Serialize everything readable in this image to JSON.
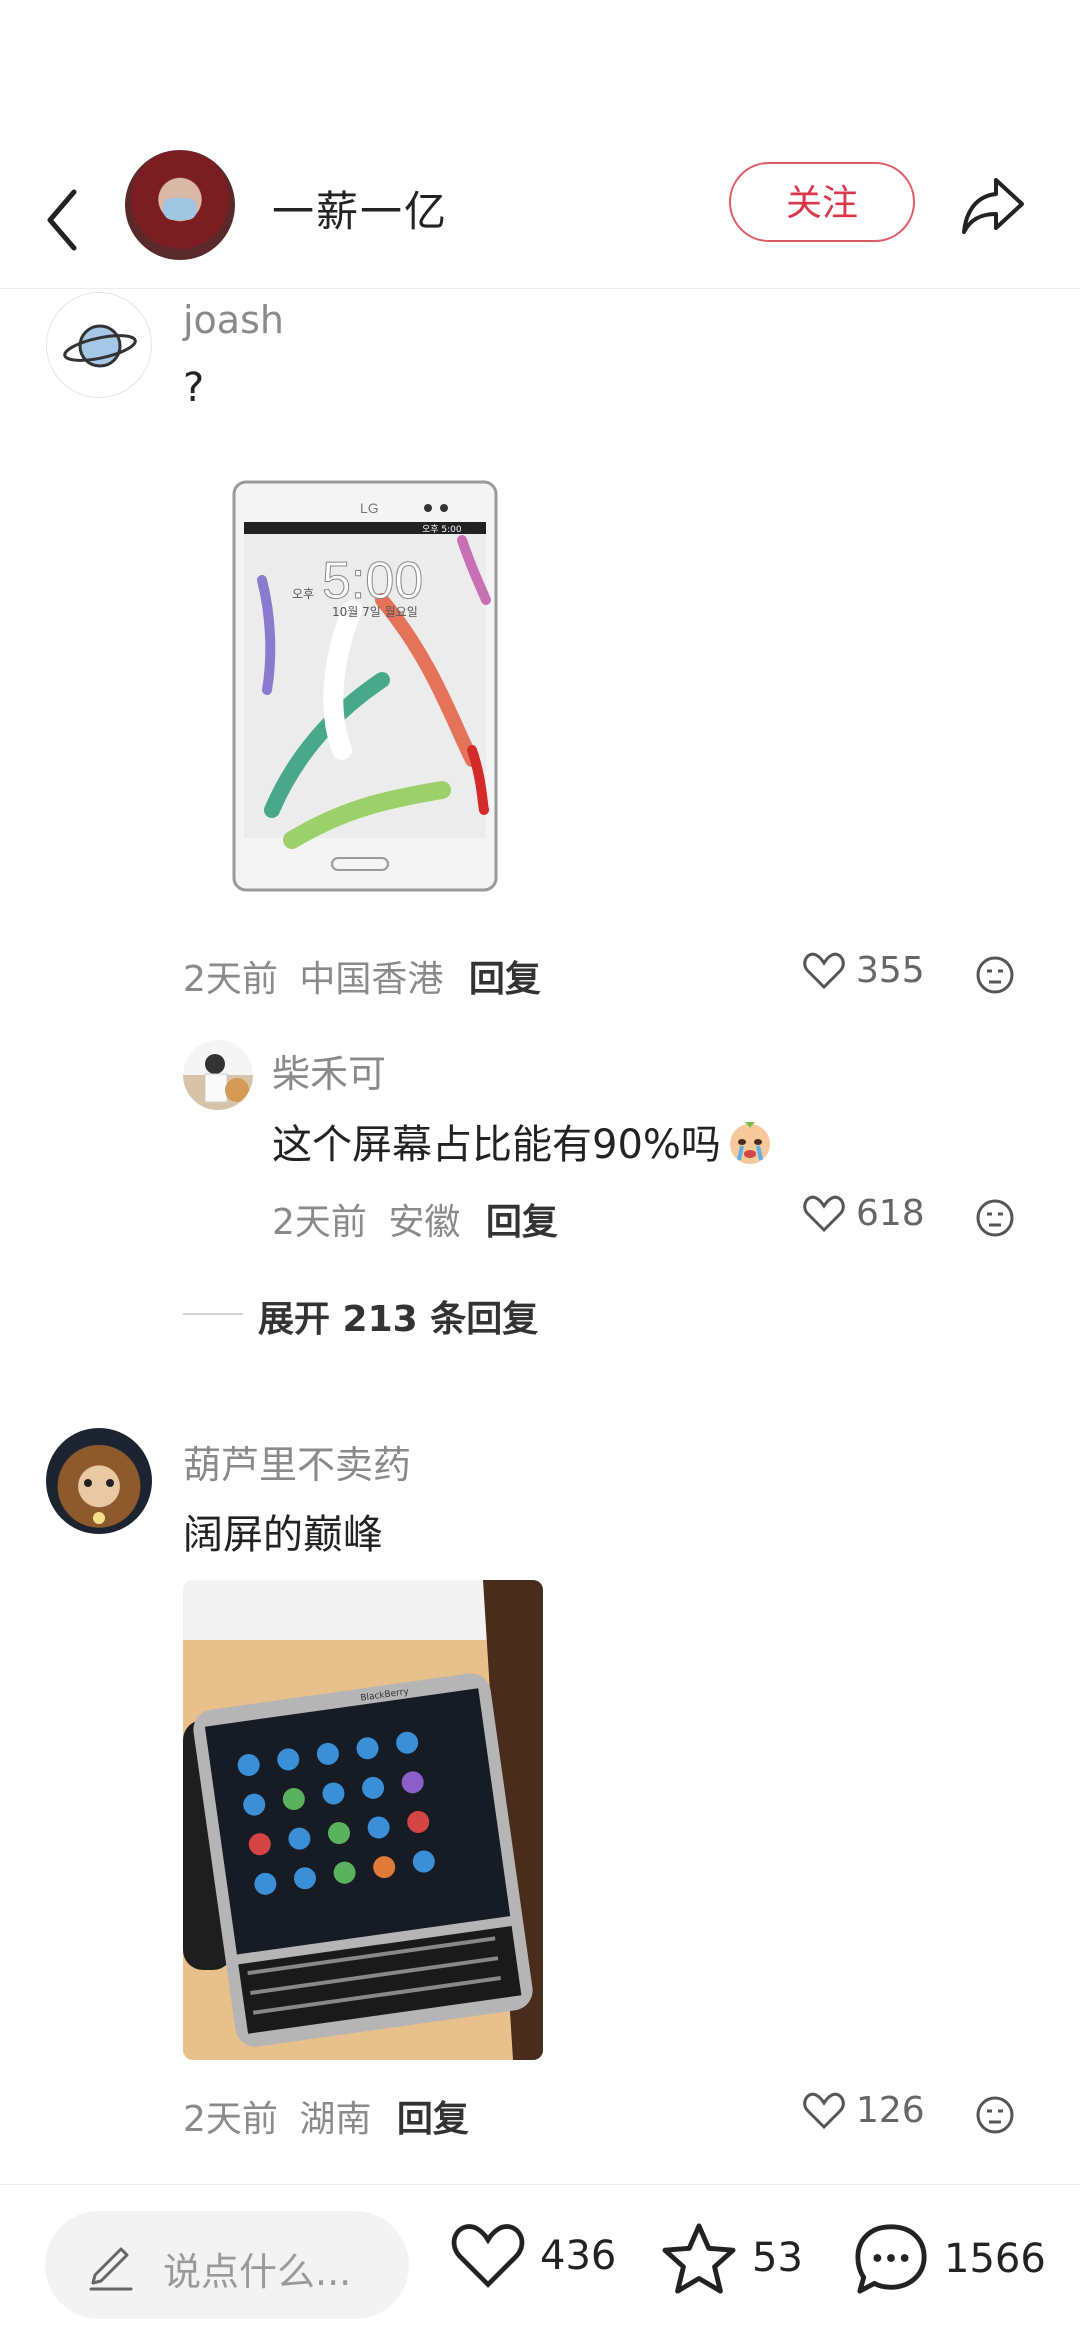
{
  "header": {
    "author_name": "一薪一亿",
    "follow_label": "关注"
  },
  "comments": [
    {
      "user": "joash",
      "text": "?",
      "image": "white LG smartphone with feather wallpaper",
      "phone_brand": "LG",
      "phone_time": "5:00",
      "phone_status": "오후 5:00",
      "phone_date": "10월 7일 월요일",
      "phone_ampm": "오후",
      "time": "2天前",
      "location": "中国香港",
      "reply_label": "回复",
      "likes": "355",
      "replies": [
        {
          "user": "柴禾可",
          "text": "这个屏幕占比能有90%吗",
          "emoji": "crying-face",
          "time": "2天前",
          "location": "安徽",
          "reply_label": "回复",
          "likes": "618"
        }
      ],
      "expand_label": "展开 213 条回复"
    },
    {
      "user": "葫芦里不卖药",
      "text": "阔屏的巅峰",
      "image": "BlackBerry Passport on wooden table",
      "phone_brand": "BlackBerry",
      "time": "2天前",
      "location": "湖南",
      "reply_label": "回复",
      "likes": "126"
    }
  ],
  "bottom_bar": {
    "input_placeholder": "说点什么...",
    "likes": "436",
    "favorites": "53",
    "comments": "1566"
  },
  "colors": {
    "accent": "#d9384a",
    "meta_text": "#8a8a8a",
    "divider": "#ececec"
  }
}
